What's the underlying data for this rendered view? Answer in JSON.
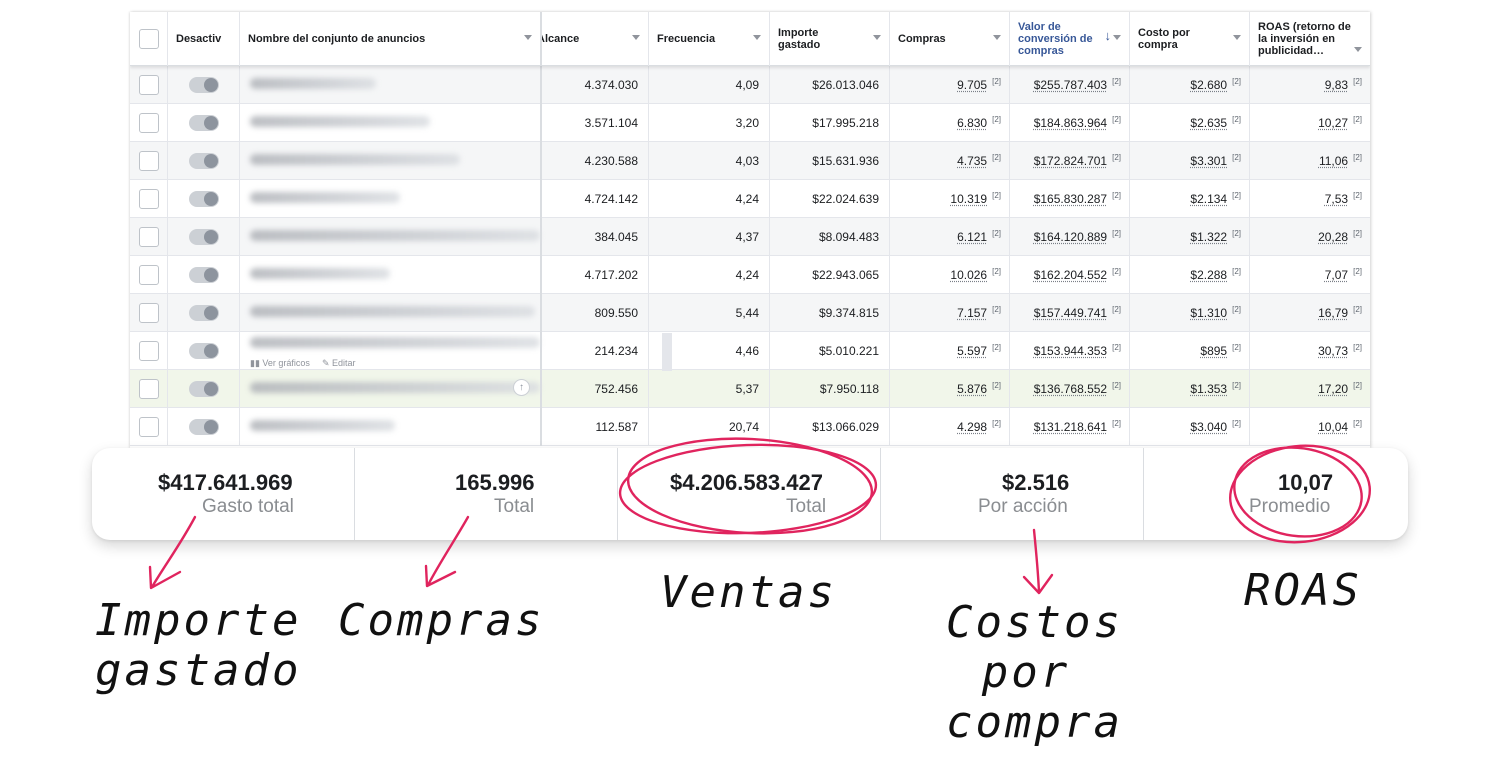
{
  "table": {
    "headers": {
      "status": "Desactiv",
      "name": "Nombre del conjunto de anuncios",
      "reach": "Alcance",
      "frequency": "Frecuencia",
      "spent": "Importe gastado",
      "purchases": "Compras",
      "conversion_value": "Valor de conversión de compras",
      "cost_per_purchase": "Costo por compra",
      "roas": "ROAS (retorno de la inversión en publicidad…"
    },
    "footnote_marker": "[2]",
    "row_actions": {
      "charts": "Ver gráficos",
      "edit": "Editar"
    },
    "rows": [
      {
        "reach": "4.374.030",
        "frequency": "4,09",
        "spent": "$26.013.046",
        "purchases": "9.705",
        "conversion_value": "$255.787.403",
        "cost_per_purchase": "$2.680",
        "roas": "9,83"
      },
      {
        "reach": "3.571.104",
        "frequency": "3,20",
        "spent": "$17.995.218",
        "purchases": "6.830",
        "conversion_value": "$184.863.964",
        "cost_per_purchase": "$2.635",
        "roas": "10,27"
      },
      {
        "reach": "4.230.588",
        "frequency": "4,03",
        "spent": "$15.631.936",
        "purchases": "4.735",
        "conversion_value": "$172.824.701",
        "cost_per_purchase": "$3.301",
        "roas": "11,06"
      },
      {
        "reach": "4.724.142",
        "frequency": "4,24",
        "spent": "$22.024.639",
        "purchases": "10.319",
        "conversion_value": "$165.830.287",
        "cost_per_purchase": "$2.134",
        "roas": "7,53"
      },
      {
        "reach": "384.045",
        "frequency": "4,37",
        "spent": "$8.094.483",
        "purchases": "6.121",
        "conversion_value": "$164.120.889",
        "cost_per_purchase": "$1.322",
        "roas": "20,28"
      },
      {
        "reach": "4.717.202",
        "frequency": "4,24",
        "spent": "$22.943.065",
        "purchases": "10.026",
        "conversion_value": "$162.204.552",
        "cost_per_purchase": "$2.288",
        "roas": "7,07"
      },
      {
        "reach": "809.550",
        "frequency": "5,44",
        "spent": "$9.374.815",
        "purchases": "7.157",
        "conversion_value": "$157.449.741",
        "cost_per_purchase": "$1.310",
        "roas": "16,79"
      },
      {
        "reach": "214.234",
        "frequency": "4,46",
        "spent": "$5.010.221",
        "purchases": "5.597",
        "conversion_value": "$153.944.353",
        "cost_per_purchase": "$895",
        "roas": "30,73"
      },
      {
        "reach": "752.456",
        "frequency": "5,37",
        "spent": "$7.950.118",
        "purchases": "5.876",
        "conversion_value": "$136.768.552",
        "cost_per_purchase": "$1.353",
        "roas": "17,20"
      },
      {
        "reach": "112.587",
        "frequency": "20,74",
        "spent": "$13.066.029",
        "purchases": "4.298",
        "conversion_value": "$131.218.641",
        "cost_per_purchase": "$3.040",
        "roas": "10,04"
      }
    ]
  },
  "summary": [
    {
      "value": "$417.641.969",
      "label": "Gasto total"
    },
    {
      "value": "165.996",
      "label": "Total"
    },
    {
      "value": "$4.206.583.427",
      "label": "Total"
    },
    {
      "value": "$2.516",
      "label": "Por acción"
    },
    {
      "value": "10,07",
      "label": "Promedio"
    }
  ],
  "annotations": {
    "spent": [
      "Importe",
      "gastado"
    ],
    "purchases": [
      "Compras"
    ],
    "sales": [
      "Ventas"
    ],
    "cost": [
      "Costos",
      "por",
      "compra"
    ],
    "roas": [
      "ROAS"
    ]
  },
  "colors": {
    "annotation": "#e0245e",
    "sorted_header": "#385898",
    "highlight_row": "#f1f6ea"
  }
}
